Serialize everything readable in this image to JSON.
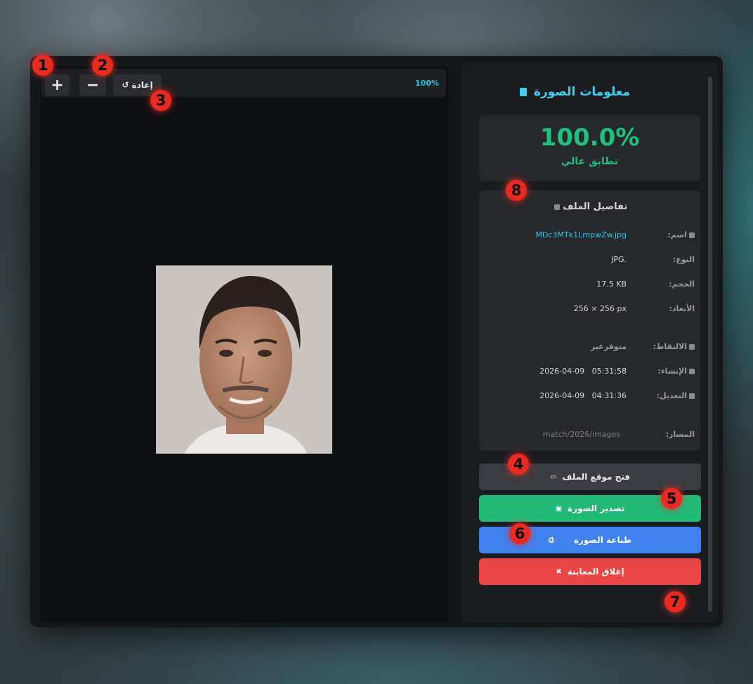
{
  "toolbar": {
    "zoom_in_label": "+",
    "zoom_out_label": "−",
    "reset_label": "إعادة",
    "reset_icon": "↺",
    "zoom_level": "100%"
  },
  "info_panel": {
    "title": "معلومات الصورة",
    "score": {
      "value": "100.0%",
      "label": "تطابق عالي"
    },
    "details": {
      "title": "تفاصيل الملف",
      "name_label": "اسم:",
      "name_value": "MDc3MTk1LmpwZw.jpg",
      "type_label": "النوع:",
      "type_value": "JPG.",
      "size_label": "الحجم:",
      "size_value": "17.5 KB",
      "dimensions_label": "الأبعاد:",
      "dimensions_value": "256 × 256 px",
      "captured_label": "الالتقاط:",
      "captured_value": "متوفرغير",
      "created_label": "الإنشاء:",
      "created_value": "2026-04-09   05:31:58",
      "modified_label": "التعديل:",
      "modified_value": "2026-04-09   04:31:36",
      "path_label": "المسار:",
      "path_value": "match/2026/images"
    },
    "actions": {
      "open_location": "فتح موقع الملف",
      "export_image": "تصدير الصورة",
      "print_image": "طباعة الصورة",
      "close_preview": "إغلاق المعاينة"
    }
  },
  "markers": [
    "1",
    "2",
    "3",
    "4",
    "5",
    "6",
    "7",
    "8"
  ],
  "colors": {
    "accent": "#3ed0ee",
    "success": "#22c07f",
    "print": "#3f82ee",
    "danger": "#ea4545",
    "marker": "#e82a22"
  }
}
